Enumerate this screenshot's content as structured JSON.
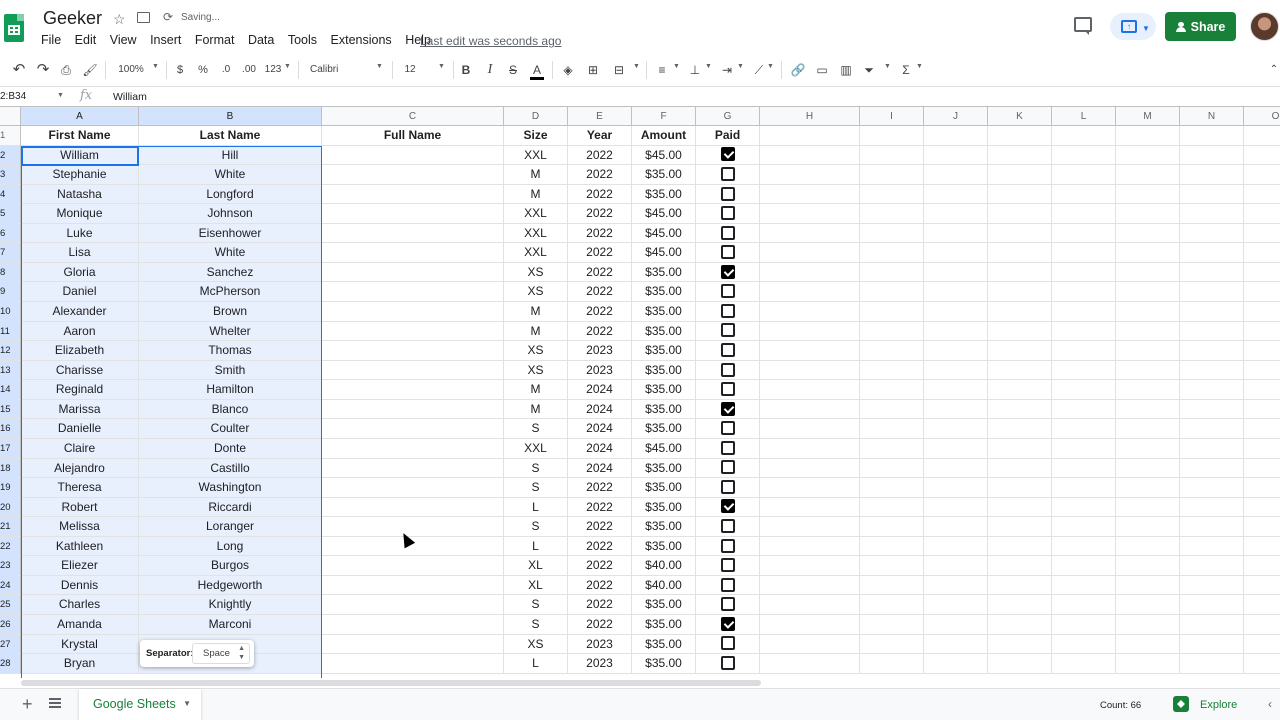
{
  "app": {
    "doc_title": "Geeker",
    "saving_status": "Saving...",
    "last_edit": "Last edit was seconds ago",
    "share_label": "Share",
    "present_label": "↑"
  },
  "menu": [
    "File",
    "Edit",
    "View",
    "Insert",
    "Format",
    "Data",
    "Tools",
    "Extensions",
    "Help"
  ],
  "toolbar": {
    "zoom": "100%",
    "currency": "$",
    "percent": "%",
    "decrease_decimal": ".0",
    "increase_decimal": ".00",
    "more_formats": "123",
    "font": "Calibri",
    "font_size": "12",
    "bold": "B",
    "italic": "I",
    "strike": "S",
    "text_color": "A",
    "functions": "Σ"
  },
  "formula_bar": {
    "name_box": "2:B34",
    "fx": "fx",
    "value": "William"
  },
  "columns": [
    "A",
    "B",
    "C",
    "D",
    "E",
    "F",
    "G",
    "H",
    "I",
    "J",
    "K",
    "L",
    "M",
    "N",
    "O"
  ],
  "headers": [
    "First Name",
    "Last Name",
    "Full Name",
    "Size",
    "Year",
    "Amount",
    "Paid"
  ],
  "rows": [
    {
      "first": "William",
      "last": "Hill",
      "size": "XXL",
      "year": "2022",
      "amount": "$45.00",
      "paid": true
    },
    {
      "first": "Stephanie",
      "last": "White",
      "size": "M",
      "year": "2022",
      "amount": "$35.00",
      "paid": false
    },
    {
      "first": "Natasha",
      "last": "Longford",
      "size": "M",
      "year": "2022",
      "amount": "$35.00",
      "paid": false
    },
    {
      "first": "Monique",
      "last": "Johnson",
      "size": "XXL",
      "year": "2022",
      "amount": "$45.00",
      "paid": false
    },
    {
      "first": "Luke",
      "last": "Eisenhower",
      "size": "XXL",
      "year": "2022",
      "amount": "$45.00",
      "paid": false
    },
    {
      "first": "Lisa",
      "last": "White",
      "size": "XXL",
      "year": "2022",
      "amount": "$45.00",
      "paid": false
    },
    {
      "first": "Gloria",
      "last": "Sanchez",
      "size": "XS",
      "year": "2022",
      "amount": "$35.00",
      "paid": true
    },
    {
      "first": "Daniel",
      "last": "McPherson",
      "size": "XS",
      "year": "2022",
      "amount": "$35.00",
      "paid": false
    },
    {
      "first": "Alexander",
      "last": "Brown",
      "size": "M",
      "year": "2022",
      "amount": "$35.00",
      "paid": false
    },
    {
      "first": "Aaron",
      "last": "Whelter",
      "size": "M",
      "year": "2022",
      "amount": "$35.00",
      "paid": false
    },
    {
      "first": "Elizabeth",
      "last": "Thomas",
      "size": "XS",
      "year": "2023",
      "amount": "$35.00",
      "paid": false
    },
    {
      "first": "Charisse",
      "last": "Smith",
      "size": "XS",
      "year": "2023",
      "amount": "$35.00",
      "paid": false
    },
    {
      "first": "Reginald",
      "last": "Hamilton",
      "size": "M",
      "year": "2024",
      "amount": "$35.00",
      "paid": false
    },
    {
      "first": "Marissa",
      "last": "Blanco",
      "size": "M",
      "year": "2024",
      "amount": "$35.00",
      "paid": true
    },
    {
      "first": "Danielle",
      "last": "Coulter",
      "size": "S",
      "year": "2024",
      "amount": "$35.00",
      "paid": false
    },
    {
      "first": "Claire",
      "last": "Donte",
      "size": "XXL",
      "year": "2024",
      "amount": "$45.00",
      "paid": false
    },
    {
      "first": "Alejandro",
      "last": "Castillo",
      "size": "S",
      "year": "2024",
      "amount": "$35.00",
      "paid": false
    },
    {
      "first": "Theresa",
      "last": "Washington",
      "size": "S",
      "year": "2022",
      "amount": "$35.00",
      "paid": false
    },
    {
      "first": "Robert",
      "last": "Riccardi",
      "size": "L",
      "year": "2022",
      "amount": "$35.00",
      "paid": true
    },
    {
      "first": "Melissa",
      "last": "Loranger",
      "size": "S",
      "year": "2022",
      "amount": "$35.00",
      "paid": false
    },
    {
      "first": "Kathleen",
      "last": "Long",
      "size": "L",
      "year": "2022",
      "amount": "$35.00",
      "paid": false
    },
    {
      "first": "Eliezer",
      "last": "Burgos",
      "size": "XL",
      "year": "2022",
      "amount": "$40.00",
      "paid": false
    },
    {
      "first": "Dennis",
      "last": "Hedgeworth",
      "size": "XL",
      "year": "2022",
      "amount": "$40.00",
      "paid": false
    },
    {
      "first": "Charles",
      "last": "Knightly",
      "size": "S",
      "year": "2022",
      "amount": "$35.00",
      "paid": false
    },
    {
      "first": "Amanda",
      "last": "Marconi",
      "size": "S",
      "year": "2022",
      "amount": "$35.00",
      "paid": true
    },
    {
      "first": "Krystal",
      "last": "",
      "size": "XS",
      "year": "2023",
      "amount": "$35.00",
      "paid": false
    },
    {
      "first": "Bryan",
      "last": "",
      "size": "L",
      "year": "2023",
      "amount": "$35.00",
      "paid": false
    }
  ],
  "separator_popup": {
    "label": "Separator:",
    "value": "Space"
  },
  "bottom": {
    "sheet_name": "Google Sheets",
    "count": "Count: 66",
    "explore": "Explore"
  },
  "colors": {
    "green": "#188038",
    "selection": "#e8f0fe",
    "selection_border": "#1a73e8"
  }
}
